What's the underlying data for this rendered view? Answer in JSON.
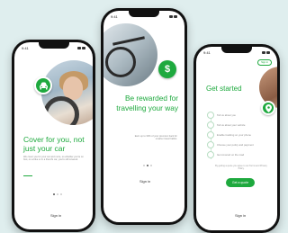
{
  "phones": {
    "left": {
      "status_time": "9:41",
      "headline": "Cover for you, not just your car",
      "body": "We cover you for your car and more, so whether you're on foot, on a bike or in a friend's car, you're still covered.",
      "signin": "Sign in"
    },
    "middle": {
      "status_time": "9:41",
      "badge": "$",
      "headline": "Be rewarded for travelling your way",
      "body": "Earn up to 30% of your premium back for smarter travel habits.",
      "signin": "Sign in"
    },
    "right": {
      "status_time": "9:41",
      "top_button": "Sign in",
      "headline": "Get started",
      "steps": [
        "Tell us about you",
        "Tell us about your vehicle",
        "Enable tracking on your phone",
        "Choose your policy and payment",
        "Get covered on the road"
      ],
      "note": "By getting a quote you agree to our Terms and Privacy Policy.",
      "quote_button": "Get a quote",
      "signin": "Sign in"
    }
  },
  "colors": {
    "brand_green": "#1ea93e",
    "background": "#dfeeee"
  }
}
